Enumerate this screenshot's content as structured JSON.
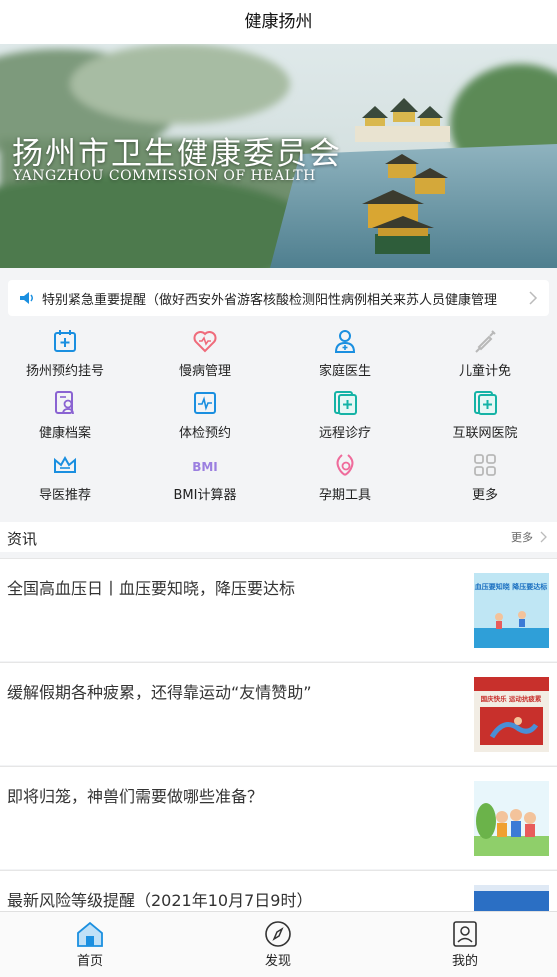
{
  "header": {
    "title": "健康扬州"
  },
  "banner": {
    "title": "扬州市卫生健康委员会",
    "subtitle": "YANGZHOU COMMISSION OF HEALTH"
  },
  "notice": {
    "icon": "speaker-icon",
    "text": "特别紧急重要提醒（做好西安外省游客核酸检测阳性病例相关来苏人员健康管理"
  },
  "services": [
    {
      "label": "扬州预约挂号",
      "icon": "calendar-plus-icon",
      "color": "#1a8fe0"
    },
    {
      "label": "慢病管理",
      "icon": "heart-pulse-icon",
      "color": "#ef6b7b"
    },
    {
      "label": "家庭医生",
      "icon": "doctor-icon",
      "color": "#1a8fe0"
    },
    {
      "label": "儿童计免",
      "icon": "syringe-icon",
      "color": "#b8b8b8"
    },
    {
      "label": "健康档案",
      "icon": "profile-doc-icon",
      "color": "#8a63d2"
    },
    {
      "label": "体检预约",
      "icon": "pulse-screen-icon",
      "color": "#1a8fe0"
    },
    {
      "label": "远程诊疗",
      "icon": "medical-card-icon",
      "color": "#15b3a6"
    },
    {
      "label": "互联网医院",
      "icon": "medical-card-icon",
      "color": "#15b3a6"
    },
    {
      "label": "导医推荐",
      "icon": "crown-icon",
      "color": "#1a8fe0"
    },
    {
      "label": "BMI计算器",
      "icon": "bmi-icon",
      "color": "#9b7fe0"
    },
    {
      "label": "孕期工具",
      "icon": "pregnancy-icon",
      "color": "#ef6b9b"
    },
    {
      "label": "更多",
      "icon": "grid-icon",
      "color": "#b8b8b8"
    }
  ],
  "news": {
    "title": "资讯",
    "more": "更多",
    "items": [
      {
        "title": "全国高血压日丨血压要知晓，降压要达标",
        "thumb_text": "血压要知晓 降压要达标"
      },
      {
        "title": "缓解假期各种疲累，还得靠运动“友情赞助”",
        "thumb_text": "国庆快乐 运动抗疲累"
      },
      {
        "title": "即将归笼，神兽们需要做哪些准备？"
      },
      {
        "title": "最新风险等级提醒（2021年10月7日9时）"
      }
    ]
  },
  "tabs": [
    {
      "label": "首页",
      "icon": "home-icon",
      "active": true
    },
    {
      "label": "发现",
      "icon": "compass-icon",
      "active": false
    },
    {
      "label": "我的",
      "icon": "profile-icon",
      "active": false
    }
  ],
  "colors": {
    "accent": "#1a8fe0",
    "background": "#f3f4f6"
  }
}
